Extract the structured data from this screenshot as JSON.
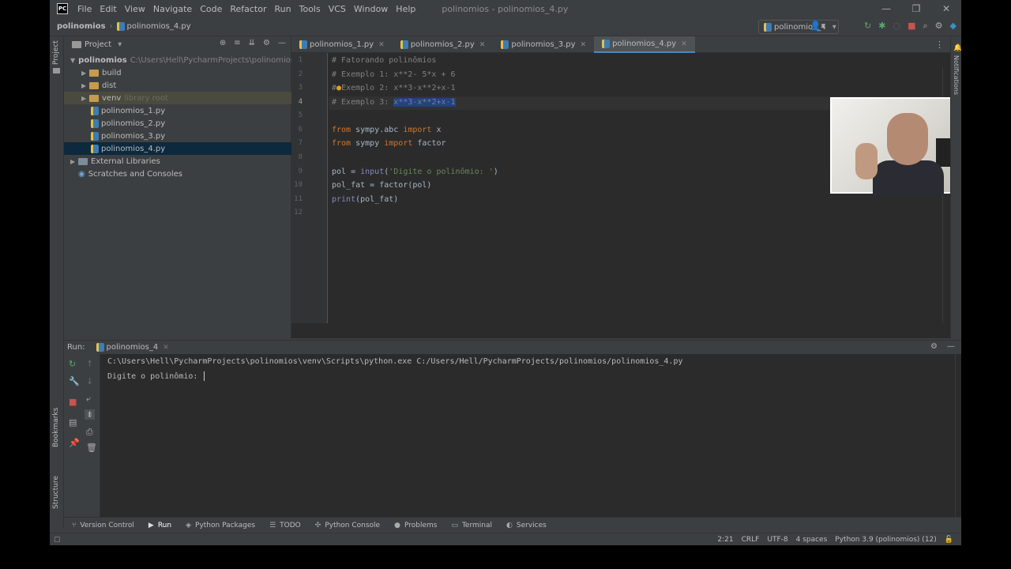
{
  "app": {
    "logo": "PC",
    "window_title": "polinomios - polinomios_4.py",
    "menu": [
      "File",
      "Edit",
      "View",
      "Navigate",
      "Code",
      "Refactor",
      "Run",
      "Tools",
      "VCS",
      "Window",
      "Help"
    ],
    "window_controls": [
      "—",
      "❐",
      "✕"
    ]
  },
  "navbar": {
    "project": "polinomios",
    "file": "polinomios_4.py",
    "run_config": "polinomios_4"
  },
  "left_strip": {
    "project_label": "Project",
    "bookmarks_label": "Bookmarks",
    "structure_label": "Structure"
  },
  "right_strip": {
    "notifications_label": "Notifications"
  },
  "project_panel": {
    "title": "Project",
    "root_name": "polinomios",
    "root_path": "C:\\Users\\Hell\\PycharmProjects\\polinomios",
    "items": [
      {
        "label": "build",
        "type": "folder"
      },
      {
        "label": "dist",
        "type": "folder"
      },
      {
        "label": "venv",
        "note": "library root",
        "type": "folder"
      },
      {
        "label": "polinomios_1.py",
        "type": "py"
      },
      {
        "label": "polinomios_2.py",
        "type": "py"
      },
      {
        "label": "polinomios_3.py",
        "type": "py"
      },
      {
        "label": "polinomios_4.py",
        "type": "py",
        "selected": true
      }
    ],
    "external": "External Libraries",
    "scratches": "Scratches and Consoles"
  },
  "tabs": [
    "polinomios_1.py",
    "polinomios_2.py",
    "polinomios_3.py",
    "polinomios_4.py"
  ],
  "active_tab": "polinomios_4.py",
  "editor": {
    "line_numbers": [
      "1",
      "2",
      "3",
      "4",
      "5",
      "6",
      "7",
      "8",
      "9",
      "10",
      "11",
      "12"
    ],
    "current_line": "4",
    "lines": {
      "l1": "# Fatorando polinômios",
      "l2": "# Exemplo 1: x**2- 5*x + 6",
      "l3a": "#",
      "l3b": "Exemplo 2: x**3-x**2+x-1",
      "l4a": "# Exemplo 3: ",
      "l4b": "x**3-x**2+x-1",
      "l6_kw1": "from",
      "l6_mod": " sympy.abc ",
      "l6_kw2": "import",
      "l6_name": " x",
      "l7_kw1": "from",
      "l7_mod": " sympy ",
      "l7_kw2": "import",
      "l7_name": " factor",
      "l9_a": "pol = ",
      "l9_fn": "input",
      "l9_b": "(",
      "l9_str": "'Digite o polinômio: '",
      "l9_c": ")",
      "l10": "pol_fat = factor(pol)",
      "l11_fn": "print",
      "l11_rest": "(pol_fat)"
    }
  },
  "run_panel": {
    "label": "Run:",
    "tab": "polinomios_4",
    "command": "C:\\Users\\Hell\\PycharmProjects\\polinomios\\venv\\Scripts\\python.exe C:/Users/Hell/PycharmProjects/polinomios/polinomios_4.py",
    "prompt": "Digite o polinômio: "
  },
  "tool_tabs": [
    {
      "label": "Version Control",
      "icon": "branch-icon"
    },
    {
      "label": "Run",
      "icon": "play-icon",
      "active": true
    },
    {
      "label": "Python Packages",
      "icon": "packages-icon"
    },
    {
      "label": "TODO",
      "icon": "list-icon"
    },
    {
      "label": "Python Console",
      "icon": "python-icon"
    },
    {
      "label": "Problems",
      "icon": "problems-icon"
    },
    {
      "label": "Terminal",
      "icon": "terminal-icon"
    },
    {
      "label": "Services",
      "icon": "services-icon"
    }
  ],
  "status": {
    "position": "2:21",
    "line_sep": "CRLF",
    "encoding": "UTF-8",
    "indent": "4 spaces",
    "interpreter": "Python 3.9 (polinomios) (12)"
  }
}
